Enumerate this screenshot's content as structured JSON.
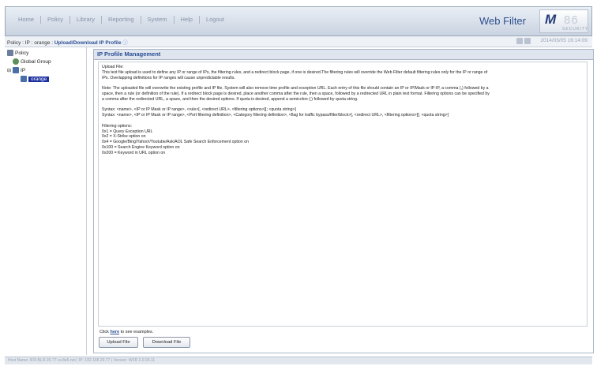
{
  "menu": [
    "Home",
    "Policy",
    "Library",
    "Reporting",
    "System",
    "Help",
    "Logout"
  ],
  "brand": {
    "title": "Web Filter",
    "logo_letter": "M",
    "logo_num": "86",
    "logo_tag": "SECURITY"
  },
  "breadcrumb": {
    "prefix": "Policy : IP : orange : ",
    "current": "Upload/Download IP Profile",
    "timestamp": "2014/03/05 16:14:09"
  },
  "tree": {
    "root": "Policy",
    "group": "Global Group",
    "ip": "IP",
    "selected": "orange"
  },
  "panel": {
    "title": "IP Profile Management",
    "lines": [
      "Upload File:",
      "This text file upload is used to define any IP or range of IPs, the filtering rules, and a redirect block page, if one is desired.The filtering rules will override the Web Filter default filtering rules only for the IP or range of",
      "IPs. Overlapping definitions for IP ranges will cause unpredictable results.",
      "",
      "Note: The uploaded file will overwrite the existing profile and IP file. System will also remove time profile and exception URL. Each entry of this file should contain an IP or IP/Mask or IP-IP, a comma (,) followed by a",
      "space, then a rule (or definition of the rule). If a redirect block page is desired, place another comma after the rule, then a space, followed by a redirected URL in plain text format. Filtering options can be specified by",
      "a comma after the redirected URL, a space, and then the desired options. If quota is desired, append a semicolon (;) followed by quota string.",
      "",
      "Syntax: <name>, <IP or IP Mask or IP range>, <rule>[, <redirect URL>, <filtering options>][; <quota string>]",
      "Syntax: <name>, <IP or IP Mask or IP range>, <Port filtering definition>, <Category filtering definition>, <flag for traffic bypass/filter/block>[, <redirect URL>, <filtering options>][; <quota string>]",
      "",
      "Filtering options:",
      "0x1 = Query Exception URL",
      "0x2 = X-Strike option on",
      "0x4 = Google/Bing/Yahoo!/Youtube/Ask/AOL Safe Search Enforcement option on",
      "0x100 = Search Engine Keyword option on",
      "0x200 = Keyword in URL option on"
    ],
    "examples_prefix": "Click",
    "examples_link": "here",
    "examples_suffix": "to see examples.",
    "upload_button": "Upload File",
    "download_button": "Download File"
  },
  "status": "Host Name: IFR-BLR-20-77.sv.8e6.net  |  IP: 192.168.20.77  |  Version: WFR 2.0.00.11"
}
